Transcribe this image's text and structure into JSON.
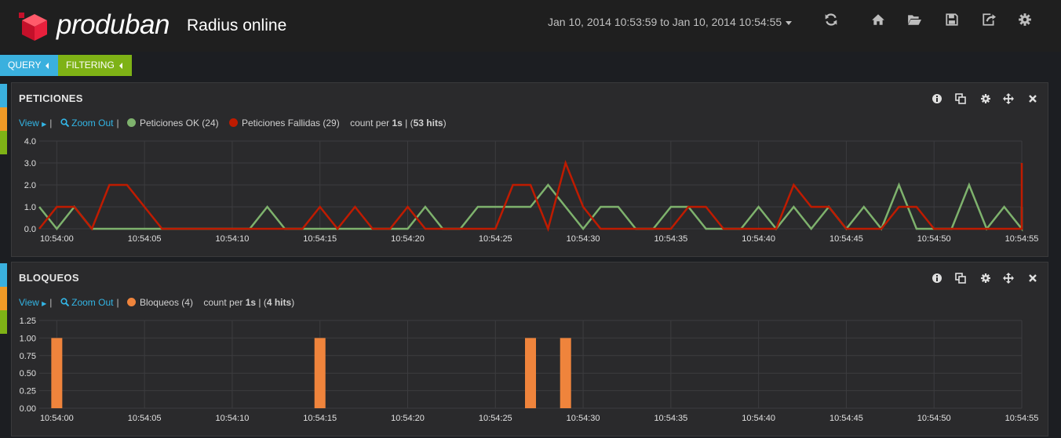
{
  "header": {
    "brand": "produban",
    "dashboard_title": "Radius online",
    "time_range": "Jan 10, 2014 10:53:59 to Jan 10, 2014 10:54:55",
    "icons": [
      "refresh-icon",
      "home-icon",
      "folder-open-icon",
      "save-icon",
      "share-icon",
      "gear-icon"
    ]
  },
  "pills": [
    {
      "label": "QUERY",
      "color": "#3ab0de"
    },
    {
      "label": "FILTERING",
      "color": "#7eb216"
    }
  ],
  "row_colors": [
    "#3ab0de",
    "#f09a26",
    "#7eb216"
  ],
  "panels": {
    "peticiones": {
      "title": "PETICIONES",
      "view_label": "View",
      "zoom_out_label": "Zoom Out",
      "legend": [
        {
          "label": "Peticiones OK (24)",
          "color": "#7eb26d"
        },
        {
          "label": "Peticiones Fallidas (29)",
          "color": "#bf1b00"
        }
      ],
      "count_text": "count per ",
      "interval": "1s",
      "hits_open": " | (",
      "hits": "53 hits",
      "hits_close": ")"
    },
    "bloqueos": {
      "title": "BLOQUEOS",
      "view_label": "View",
      "zoom_out_label": "Zoom Out",
      "legend": [
        {
          "label": "Bloqueos (4)",
          "color": "#ef843c"
        }
      ],
      "count_text": "count per ",
      "interval": "1s",
      "hits_open": " | (",
      "hits": "4 hits",
      "hits_close": ")"
    }
  },
  "chart_data": [
    {
      "type": "line",
      "xlim": [
        "10:53:59",
        "10:54:55"
      ],
      "x_ticks": [
        "10:54:00",
        "10:54:05",
        "10:54:10",
        "10:54:15",
        "10:54:20",
        "10:54:25",
        "10:54:30",
        "10:54:35",
        "10:54:40",
        "10:54:45",
        "10:54:50",
        "10:54:55"
      ],
      "y_ticks": [
        "0.0",
        "1.0",
        "2.0",
        "3.0",
        "4.0"
      ],
      "ylim": [
        0,
        4
      ],
      "grid": true,
      "series": [
        {
          "name": "Peticiones OK",
          "color": "#7eb26d",
          "values": [
            1,
            0,
            1,
            0,
            0,
            0,
            0,
            0,
            0,
            0,
            0,
            0,
            0,
            1,
            0,
            0,
            0,
            0,
            0,
            0,
            0,
            0,
            1,
            0,
            0,
            1,
            1,
            1,
            1,
            2,
            1,
            0,
            1,
            1,
            0,
            0,
            1,
            1,
            0,
            0,
            0,
            1,
            0,
            1,
            0,
            1,
            0,
            1,
            0,
            2,
            0,
            0,
            0,
            2,
            0,
            1,
            0,
            1,
            0,
            0
          ]
        },
        {
          "name": "Peticiones Fallidas",
          "color": "#bf1b00",
          "values": [
            0,
            1,
            1,
            0,
            2,
            2,
            1,
            0,
            0,
            0,
            0,
            0,
            0,
            0,
            0,
            0,
            1,
            0,
            1,
            0,
            0,
            1,
            0,
            0,
            0,
            0,
            0,
            2,
            2,
            0,
            3,
            1,
            0,
            0,
            0,
            0,
            0,
            1,
            1,
            0,
            0,
            0,
            0,
            2,
            1,
            1,
            0,
            0,
            0,
            1,
            1,
            0,
            0,
            0,
            0,
            0,
            0,
            3
          ]
        }
      ]
    },
    {
      "type": "bar",
      "xlim": [
        "10:53:59",
        "10:54:55"
      ],
      "x_ticks": [
        "10:54:00",
        "10:54:05",
        "10:54:10",
        "10:54:15",
        "10:54:20",
        "10:54:25",
        "10:54:30",
        "10:54:35",
        "10:54:40",
        "10:54:45",
        "10:54:50",
        "10:54:55"
      ],
      "y_ticks": [
        "0.00",
        "0.25",
        "0.50",
        "0.75",
        "1.00",
        "1.25"
      ],
      "ylim": [
        0,
        1.25
      ],
      "grid": true,
      "series": [
        {
          "name": "Bloqueos",
          "color": "#ef843c",
          "points": [
            [
              "10:54:00",
              1
            ],
            [
              "10:54:15",
              1
            ],
            [
              "10:54:27",
              1
            ],
            [
              "10:54:29",
              1
            ]
          ]
        }
      ]
    }
  ]
}
